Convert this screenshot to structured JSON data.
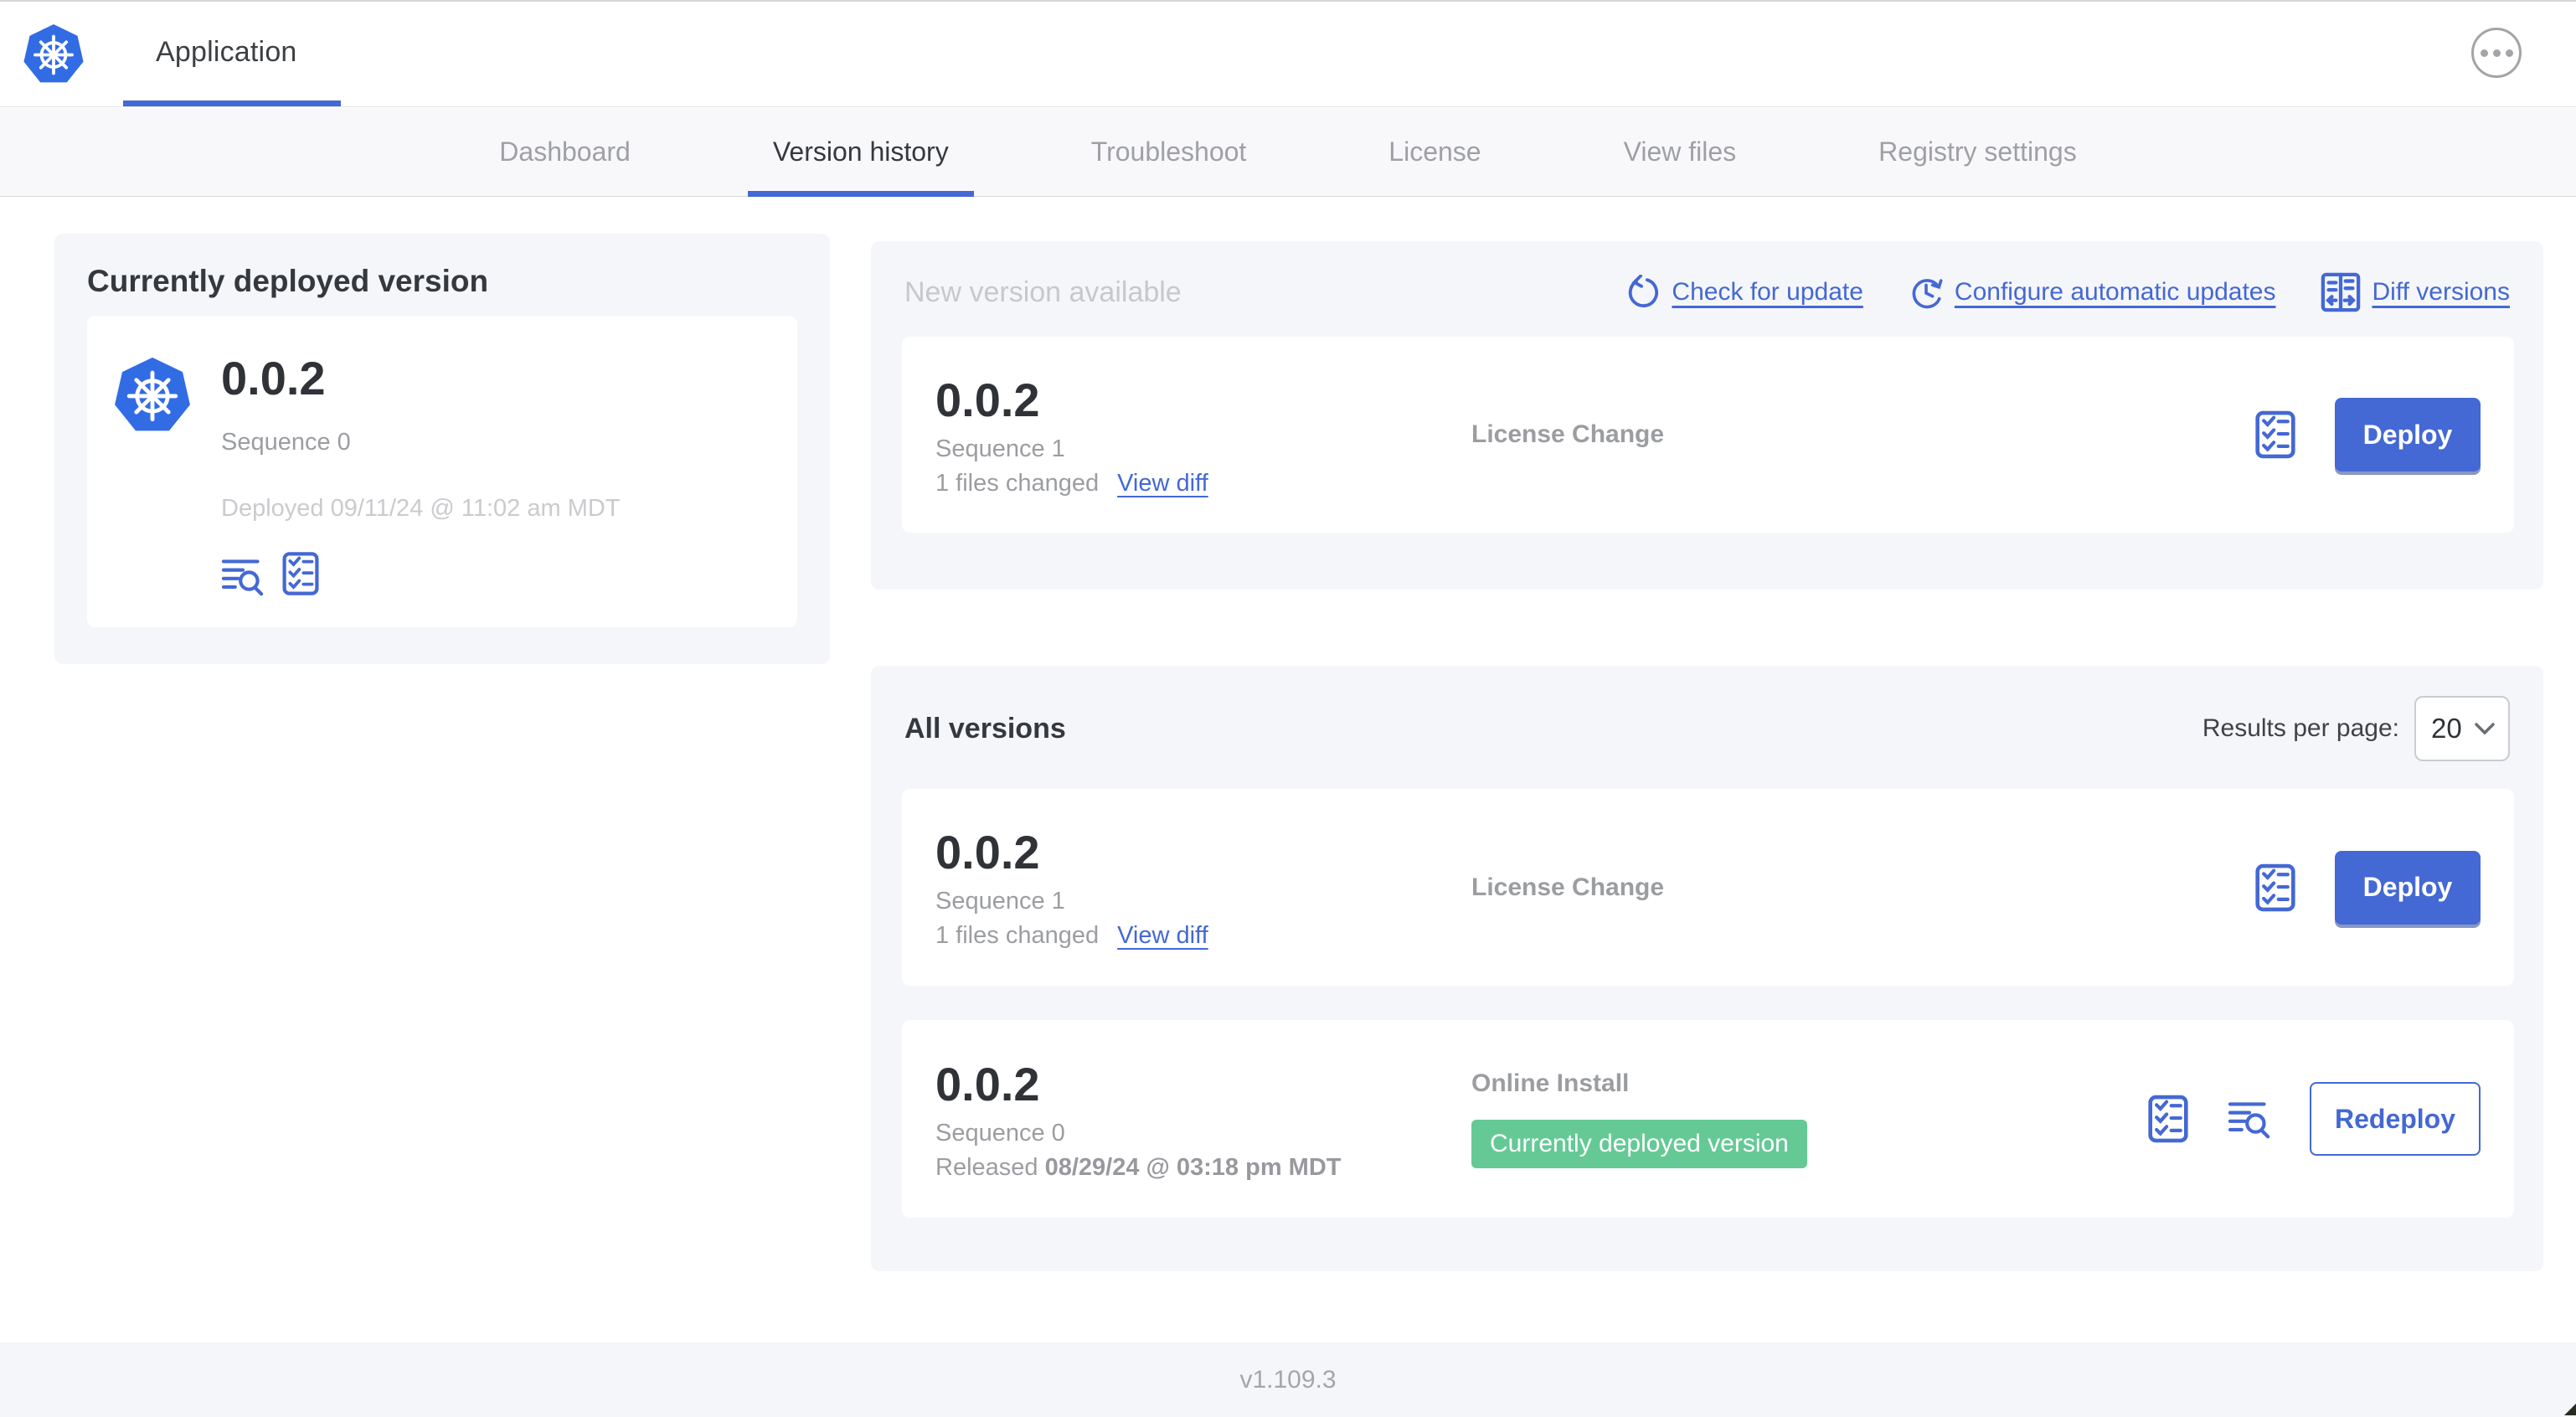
{
  "header": {
    "app_title": "Application"
  },
  "nav": {
    "tabs": [
      {
        "label": "Dashboard"
      },
      {
        "label": "Version history"
      },
      {
        "label": "Troubleshoot"
      },
      {
        "label": "License"
      },
      {
        "label": "View files"
      },
      {
        "label": "Registry settings"
      }
    ],
    "active_tab": "Version history"
  },
  "current_deployed": {
    "title": "Currently deployed version",
    "version": "0.0.2",
    "sequence": "Sequence 0",
    "deployed": "Deployed 09/11/24 @ 11:02 am MDT"
  },
  "new_version": {
    "title": "New version available",
    "actions": [
      {
        "label": "Check for update",
        "icon": "refresh-icon"
      },
      {
        "label": "Configure automatic updates",
        "icon": "auto-update-icon"
      },
      {
        "label": "Diff versions",
        "icon": "diff-icon"
      }
    ],
    "row": {
      "version": "0.0.2",
      "sequence": "Sequence 1",
      "files_changed": "1 files changed",
      "view_diff_label": "View diff",
      "source": "License Change",
      "action_label": "Deploy"
    }
  },
  "all_versions": {
    "title": "All versions",
    "results_per_page_label": "Results per page:",
    "results_per_page_value": "20",
    "rows": [
      {
        "version": "0.0.2",
        "sequence": "Sequence 1",
        "files_changed": "1 files changed",
        "view_diff_label": "View diff",
        "source": "License Change",
        "action_label": "Deploy"
      },
      {
        "version": "0.0.2",
        "sequence": "Sequence 0",
        "released_prefix": "Released",
        "released_date": "08/29/24 @ 03:18 pm MDT",
        "source": "Online Install",
        "badge": "Currently deployed version",
        "action_label": "Redeploy"
      }
    ]
  },
  "footer": {
    "app_version": "v1.109.3"
  },
  "colors": {
    "accent_blue": "#4468d4",
    "kubernetes_blue": "#326ce5",
    "badge_green": "#65c996",
    "panel_bg": "#f5f6f9"
  }
}
